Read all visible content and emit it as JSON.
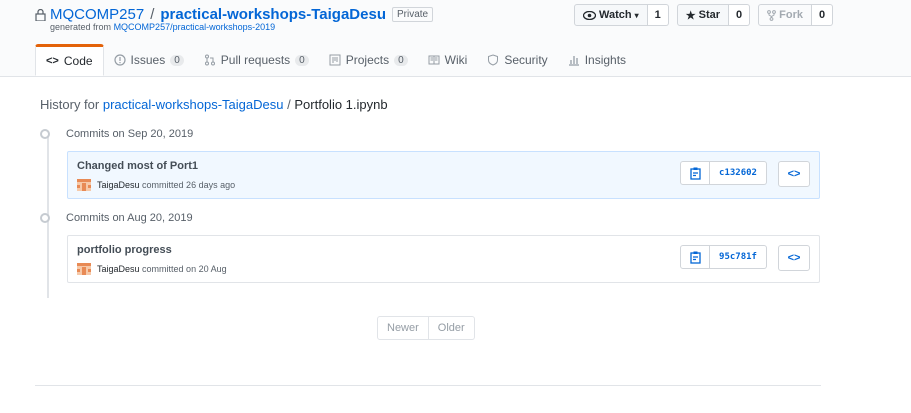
{
  "repo": {
    "owner": "MQCOMP257",
    "separator": "/",
    "name": "practical-workshops-TaigaDesu",
    "visibility": "Private",
    "generated_prefix": "generated from",
    "template_link": "MQCOMP257/practical-workshops-2019"
  },
  "actions": {
    "watch_label": "Watch",
    "watch_count": "1",
    "star_label": "Star",
    "star_count": "0",
    "fork_label": "Fork",
    "fork_count": "0"
  },
  "tabs": [
    {
      "label": "Code",
      "icon": "code-icon",
      "selected": true
    },
    {
      "label": "Issues",
      "count": "0",
      "icon": "issue-icon"
    },
    {
      "label": "Pull requests",
      "count": "0",
      "icon": "pull-request-icon"
    },
    {
      "label": "Projects",
      "count": "0",
      "icon": "project-icon"
    },
    {
      "label": "Wiki",
      "icon": "book-icon"
    },
    {
      "label": "Security",
      "icon": "shield-icon"
    },
    {
      "label": "Insights",
      "icon": "graph-icon"
    }
  ],
  "history": {
    "prefix": "History for",
    "repo_link": "practical-workshops-TaigaDesu",
    "separator": "/",
    "file": "Portfolio 1.ipynb"
  },
  "groups": [
    {
      "heading": "Commits on Sep 20, 2019",
      "commit": {
        "message": "Changed most of Port1",
        "author": "TaigaDesu",
        "when": "committed 26 days ago",
        "sha": "c132602",
        "browse": "<>"
      }
    },
    {
      "heading": "Commits on Aug 20, 2019",
      "commit": {
        "message": "portfolio progress",
        "author": "TaigaDesu",
        "when": "committed on 20 Aug",
        "sha": "95c781f",
        "browse": "<>"
      }
    }
  ],
  "pagination": {
    "newer": "Newer",
    "older": "Older"
  },
  "colors": {
    "accent": "#0366d6",
    "tab_border": "#e36209",
    "highlight_bg": "#f1f8ff"
  }
}
